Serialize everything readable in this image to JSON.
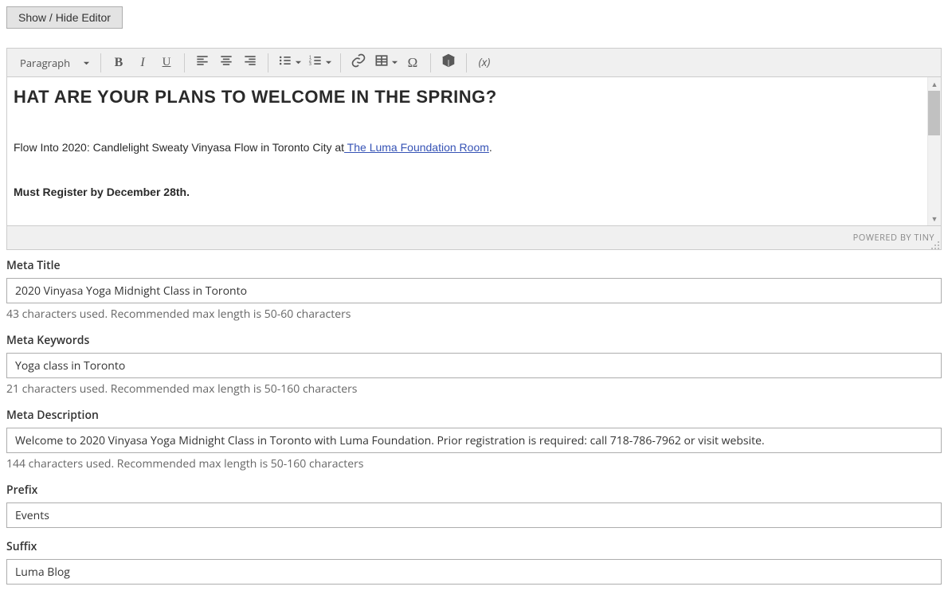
{
  "toggle_label": "Show / Hide Editor",
  "toolbar": {
    "format_label": "Paragraph"
  },
  "content": {
    "heading": "HAT ARE YOUR PLANS TO WELCOME IN THE SPRING?",
    "body_prefix": "Flow Into 2020: Candlelight Sweaty Vinyasa Flow in Toronto City at",
    "body_link": " The Luma Foundation Room",
    "body_suffix": ".",
    "bold_line": "Must Register by December 28th."
  },
  "statusbar": {
    "powered": "POWERED BY TINY"
  },
  "fields": {
    "meta_title": {
      "label": "Meta Title",
      "value": "2020 Vinyasa Yoga Midnight Class in Toronto",
      "hint": "43 characters used. Recommended max length is 50-60 characters"
    },
    "meta_keywords": {
      "label": "Meta Keywords",
      "value": "Yoga class in Toronto",
      "hint": "21 characters used. Recommended max length is 50-160 characters"
    },
    "meta_description": {
      "label": "Meta Description",
      "value": "Welcome to 2020 Vinyasa Yoga Midnight Class in Toronto with Luma Foundation. Prior registration is required: call 718-786-7962 or visit website.",
      "hint": "144 characters used. Recommended max length is 50-160 characters"
    },
    "prefix": {
      "label": "Prefix",
      "value": "Events"
    },
    "suffix": {
      "label": "Suffix",
      "value": "Luma Blog"
    }
  }
}
